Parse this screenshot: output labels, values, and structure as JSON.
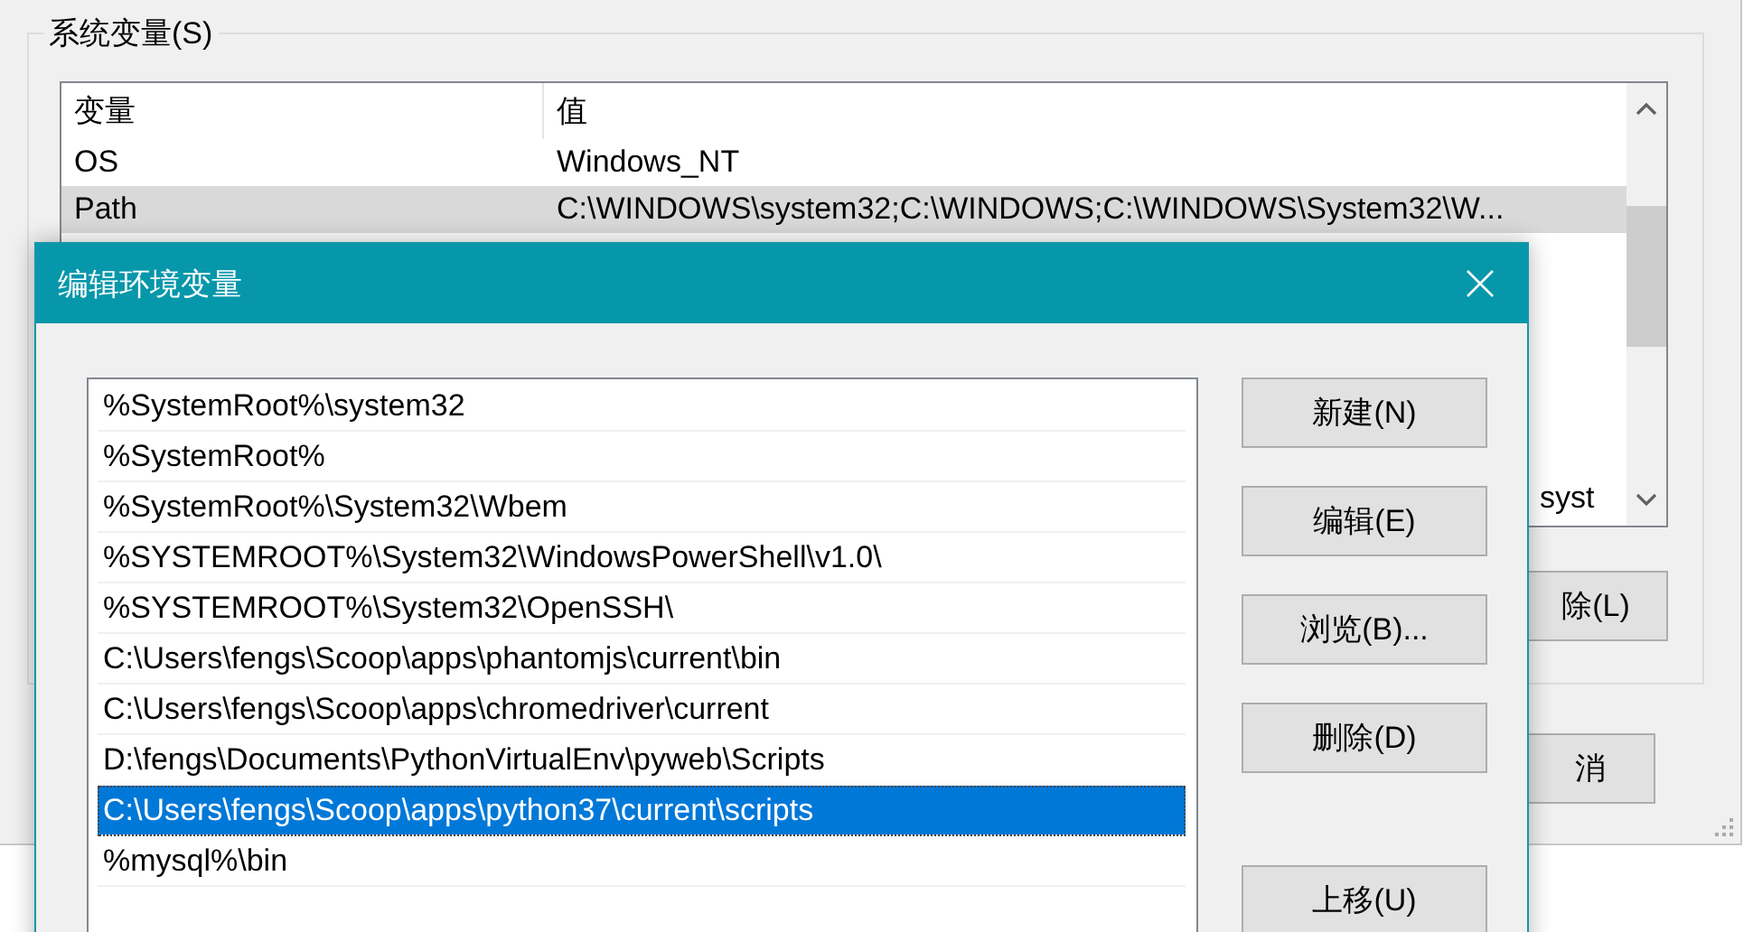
{
  "background_window": {
    "group_title": "系统变量(S)",
    "table": {
      "columns": [
        "变量",
        "值"
      ],
      "rows": [
        {
          "name": "OS",
          "value": "Windows_NT",
          "selected": false
        },
        {
          "name": "Path",
          "value": "C:\\WINDOWS\\system32;C:\\WINDOWS;C:\\WINDOWS\\System32\\W...",
          "selected": true
        }
      ]
    },
    "partial_text": "syst",
    "group_button": "除(L)",
    "bottom_button": "消"
  },
  "dialog": {
    "title": "编辑环境变量",
    "items": [
      {
        "text": "%SystemRoot%\\system32",
        "selected": false
      },
      {
        "text": "%SystemRoot%",
        "selected": false
      },
      {
        "text": "%SystemRoot%\\System32\\Wbem",
        "selected": false
      },
      {
        "text": "%SYSTEMROOT%\\System32\\WindowsPowerShell\\v1.0\\",
        "selected": false
      },
      {
        "text": "%SYSTEMROOT%\\System32\\OpenSSH\\",
        "selected": false
      },
      {
        "text": "C:\\Users\\fengs\\Scoop\\apps\\phantomjs\\current\\bin",
        "selected": false
      },
      {
        "text": "C:\\Users\\fengs\\Scoop\\apps\\chromedriver\\current",
        "selected": false
      },
      {
        "text": "D:\\fengs\\Documents\\PythonVirtualEnv\\pyweb\\Scripts",
        "selected": false
      },
      {
        "text": "C:\\Users\\fengs\\Scoop\\apps\\python37\\current\\scripts",
        "selected": true
      },
      {
        "text": "%mysql%\\bin",
        "selected": false
      }
    ],
    "buttons": [
      "新建(N)",
      "编辑(E)",
      "浏览(B)...",
      "删除(D)"
    ],
    "lower_buttons": [
      "上移(U)"
    ]
  }
}
